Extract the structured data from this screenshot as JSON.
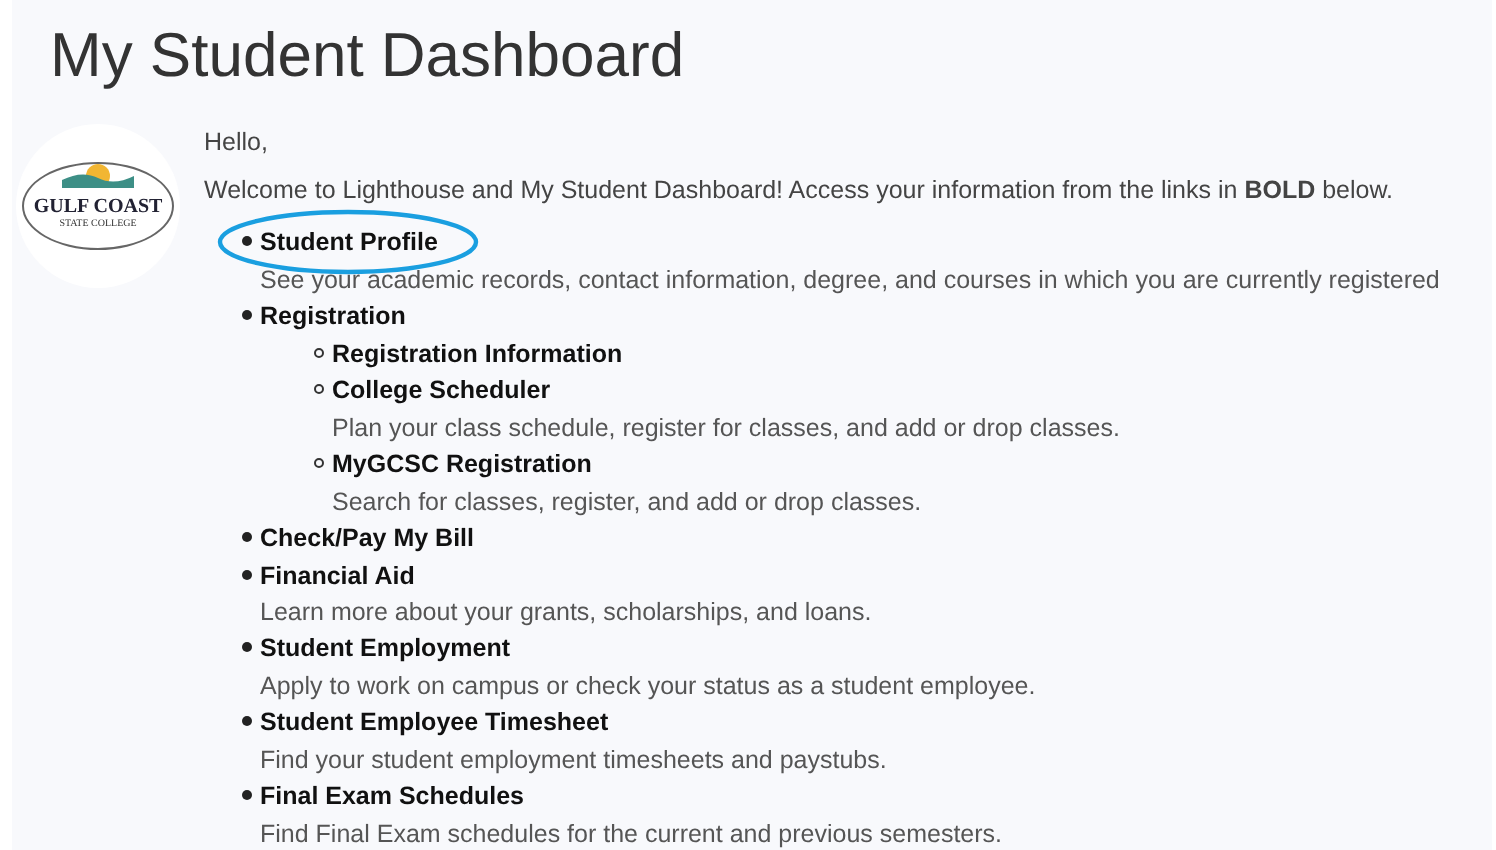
{
  "title": "My Student Dashboard",
  "logo": {
    "line_1": "GULF COAST",
    "line_2": "STATE COLLEGE"
  },
  "greeting": "Hello,",
  "intro": "Welcome to Lighthouse and My Student Dashboard! Access your information from the links in **BOLD** below.",
  "links": [
    {
      "label": "Student Profile",
      "circled": true,
      "description": "See your academic records, contact information, degree, and courses in which you are currently registered"
    },
    {
      "label": "Registration",
      "circled": false,
      "children": [
        {
          "label": "Registration Information",
          "circled": false
        },
        {
          "label": "College Scheduler",
          "circled": false,
          "description": "Plan your class schedule, register for classes, and add or drop classes."
        },
        {
          "label": "MyGCSC Registration",
          "circled": false,
          "description": "Search for classes, register, and add or drop classes."
        }
      ]
    },
    {
      "label": "Check/Pay My Bill",
      "circled": false
    },
    {
      "label": "Financial Aid",
      "circled": false,
      "description": "Learn more about your grants, scholarships, and loans."
    },
    {
      "label": "Student Employment",
      "circled": false,
      "description": "Apply to work on campus or check your status as a student employee."
    },
    {
      "label": "Student Employee Timesheet",
      "circled": false,
      "description": "Find your student employment timesheets and paystubs."
    },
    {
      "label": "Final Exam Schedules",
      "circled": false,
      "description": "Find Final Exam schedules for the current and previous semesters."
    }
  ]
}
